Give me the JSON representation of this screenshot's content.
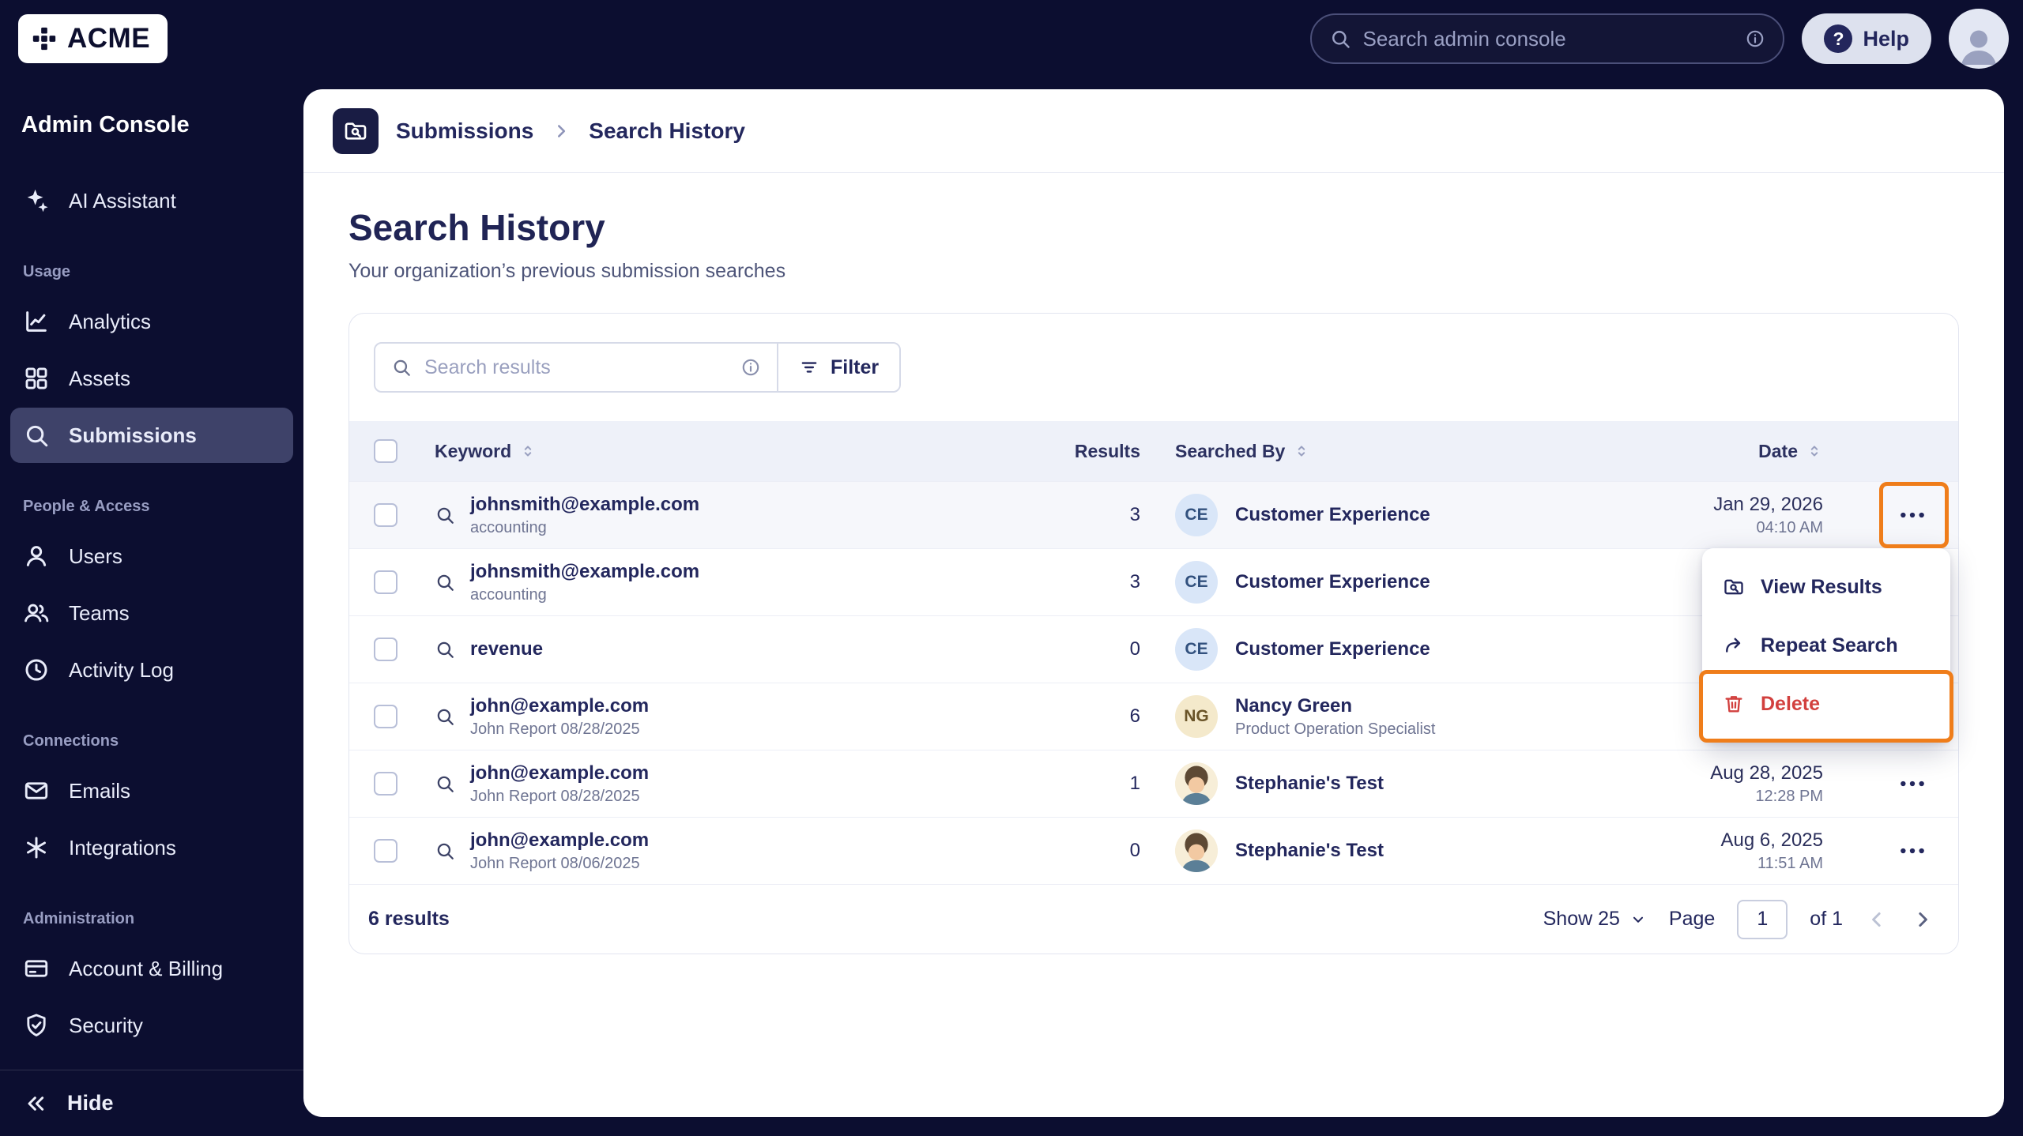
{
  "annotation": {
    "highlight_color": "#ef7d1a"
  },
  "topbar": {
    "brand": "ACME",
    "search_placeholder": "Search admin console",
    "help_label": "Help"
  },
  "sidebar": {
    "title": "Admin Console",
    "assistant_label": "AI Assistant",
    "sections": [
      {
        "label": "Usage",
        "items": [
          {
            "label": "Analytics",
            "icon": "line-chart-icon",
            "active": false
          },
          {
            "label": "Assets",
            "icon": "grid-icon",
            "active": false
          },
          {
            "label": "Submissions",
            "icon": "search-icon",
            "active": true
          }
        ]
      },
      {
        "label": "People & Access",
        "items": [
          {
            "label": "Users",
            "icon": "user-icon",
            "active": false
          },
          {
            "label": "Teams",
            "icon": "users-icon",
            "active": false
          },
          {
            "label": "Activity Log",
            "icon": "clock-icon",
            "active": false
          }
        ]
      },
      {
        "label": "Connections",
        "items": [
          {
            "label": "Emails",
            "icon": "envelope-icon",
            "active": false
          },
          {
            "label": "Integrations",
            "icon": "integration-icon",
            "active": false
          }
        ]
      },
      {
        "label": "Administration",
        "items": [
          {
            "label": "Account & Billing",
            "icon": "credit-card-icon",
            "active": false
          },
          {
            "label": "Security",
            "icon": "shield-icon",
            "active": false
          }
        ]
      }
    ],
    "hide_label": "Hide"
  },
  "breadcrumb": {
    "parent": "Submissions",
    "current": "Search History"
  },
  "page": {
    "title": "Search History",
    "subtitle": "Your organization’s previous submission searches"
  },
  "toolbar": {
    "search_placeholder": "Search results",
    "filter_label": "Filter"
  },
  "table": {
    "headers": {
      "keyword": "Keyword",
      "results": "Results",
      "searched_by": "Searched By",
      "date": "Date"
    },
    "rows": [
      {
        "keyword": "johnsmith@example.com",
        "sub": "accounting",
        "results": "3",
        "avatar_text": "CE",
        "name": "Customer Experience",
        "role": "",
        "date": "Jan 29, 2026",
        "time": "04:10 AM"
      },
      {
        "keyword": "johnsmith@example.com",
        "sub": "accounting",
        "results": "3",
        "avatar_text": "CE",
        "name": "Customer Experience",
        "role": "",
        "date": "",
        "time": ""
      },
      {
        "keyword": "revenue",
        "sub": "",
        "results": "0",
        "avatar_text": "CE",
        "name": "Customer Experience",
        "role": "",
        "date": "",
        "time": ""
      },
      {
        "keyword": "john@example.com",
        "sub": "John Report 08/28/2025",
        "results": "6",
        "avatar_text": "NG",
        "name": "Nancy Green",
        "role": "Product Operation Specialist",
        "date": "",
        "time": ""
      },
      {
        "keyword": "john@example.com",
        "sub": "John Report 08/28/2025",
        "results": "1",
        "avatar_text": "",
        "name": "Stephanie's Test",
        "role": "",
        "date": "Aug 28, 2025",
        "time": "12:28 PM"
      },
      {
        "keyword": "john@example.com",
        "sub": "John Report 08/06/2025",
        "results": "0",
        "avatar_text": "",
        "name": "Stephanie's Test",
        "role": "",
        "date": "Aug 6, 2025",
        "time": "11:51 AM"
      }
    ]
  },
  "row_menu": {
    "items": [
      {
        "label": "View Results",
        "icon": "folder-search-icon",
        "danger": false
      },
      {
        "label": "Repeat Search",
        "icon": "repeat-icon",
        "danger": false
      },
      {
        "label": "Delete",
        "icon": "trash-icon",
        "danger": true
      }
    ]
  },
  "footer": {
    "results_label": "6 results",
    "show_label": "Show 25",
    "page_label": "Page",
    "page_value": "1",
    "of_label": "of 1"
  }
}
